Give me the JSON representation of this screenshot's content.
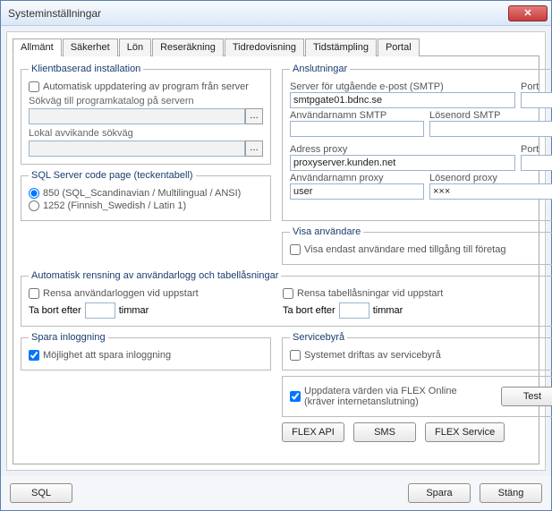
{
  "window": {
    "title": "Systeminställningar"
  },
  "tabs": [
    "Allmänt",
    "Säkerhet",
    "Lön",
    "Reseräkning",
    "Tidredovisning",
    "Tidstämpling",
    "Portal"
  ],
  "activeTab": 0,
  "klient": {
    "legend": "Klientbaserad installation",
    "auto_update": "Automatisk uppdatering av program från server",
    "path_label": "Sökväg till programkatalog på servern",
    "path_value": "",
    "local_label": "Lokal avvikande sökväg",
    "local_value": ""
  },
  "anslut": {
    "legend": "Anslutningar",
    "smtp_server_label": "Server för utgående e-post (SMTP)",
    "port_label": "Port",
    "smtp_server": "smtpgate01.bdnc.se",
    "smtp_port": "",
    "smtp_user_label": "Användarnamn SMTP",
    "smtp_pass_label": "Lösenord SMTP",
    "smtp_user": "",
    "smtp_pass": "",
    "proxy_addr_label": "Adress proxy",
    "proxy_addr": "proxyserver.kunden.net",
    "proxy_port_label": "Port",
    "proxy_port": "",
    "proxy_user_label": "Användarnamn proxy",
    "proxy_pass_label": "Lösenord proxy",
    "proxy_user": "user",
    "proxy_pass": "×××"
  },
  "codepage": {
    "legend": "SQL Server code page (teckentabell)",
    "opt850": "850 (SQL_Scandinavian / Multilingual / ANSI)",
    "opt1252": "1252 (Finnish_Swedish / Latin 1)"
  },
  "visa": {
    "legend": "Visa användare",
    "only": "Visa endast användare med tillgång till företag"
  },
  "rensning": {
    "legend": "Automatisk rensning av användarlogg och tabellåsningar",
    "rensa_log": "Rensa användarloggen vid uppstart",
    "rensa_lock": "Rensa tabellåsningar vid uppstart",
    "tabort_label": "Ta bort efter",
    "timmar": "timmar"
  },
  "spara_inl": {
    "legend": "Spara inloggning",
    "option": "Möjlighet att spara inloggning"
  },
  "servicebyra": {
    "legend": "Servicebyrå",
    "option": "Systemet driftas av servicebyrå"
  },
  "flex": {
    "update_label": "Uppdatera värden via FLEX Online (kräver internetanslutning)",
    "test": "Test",
    "api": "FLEX API",
    "sms": "SMS",
    "service": "FLEX Service"
  },
  "bottom": {
    "sql": "SQL",
    "spara": "Spara",
    "stang": "Stäng"
  }
}
